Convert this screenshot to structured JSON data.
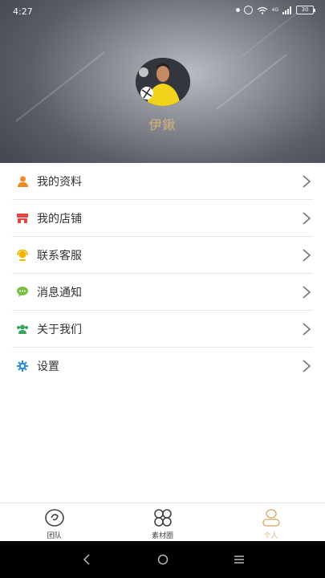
{
  "status_bar": {
    "time": "4:27",
    "network": "4G",
    "battery": "30"
  },
  "profile": {
    "username": "伊鍬"
  },
  "menu": [
    {
      "label": "我的资料",
      "icon": "person-icon",
      "color": "#f08a24"
    },
    {
      "label": "我的店铺",
      "icon": "shop-icon",
      "color": "#e8453c"
    },
    {
      "label": "联系客服",
      "icon": "headset-icon",
      "color": "#f5b400"
    },
    {
      "label": "消息通知",
      "icon": "chat-bubble-icon",
      "color": "#7ac143"
    },
    {
      "label": "关于我们",
      "icon": "people-icon",
      "color": "#3aa55d"
    },
    {
      "label": "设置",
      "icon": "gear-icon",
      "color": "#2f8de4"
    }
  ],
  "tabs": [
    {
      "label": "团队",
      "icon": "team-icon",
      "active": false
    },
    {
      "label": "素材圈",
      "icon": "grid-icon",
      "active": false
    },
    {
      "label": "个人",
      "icon": "person-outline-icon",
      "active": true
    }
  ],
  "colors": {
    "accent": "#d9b47a",
    "text": "#333333",
    "divider": "#e6e6e6"
  }
}
